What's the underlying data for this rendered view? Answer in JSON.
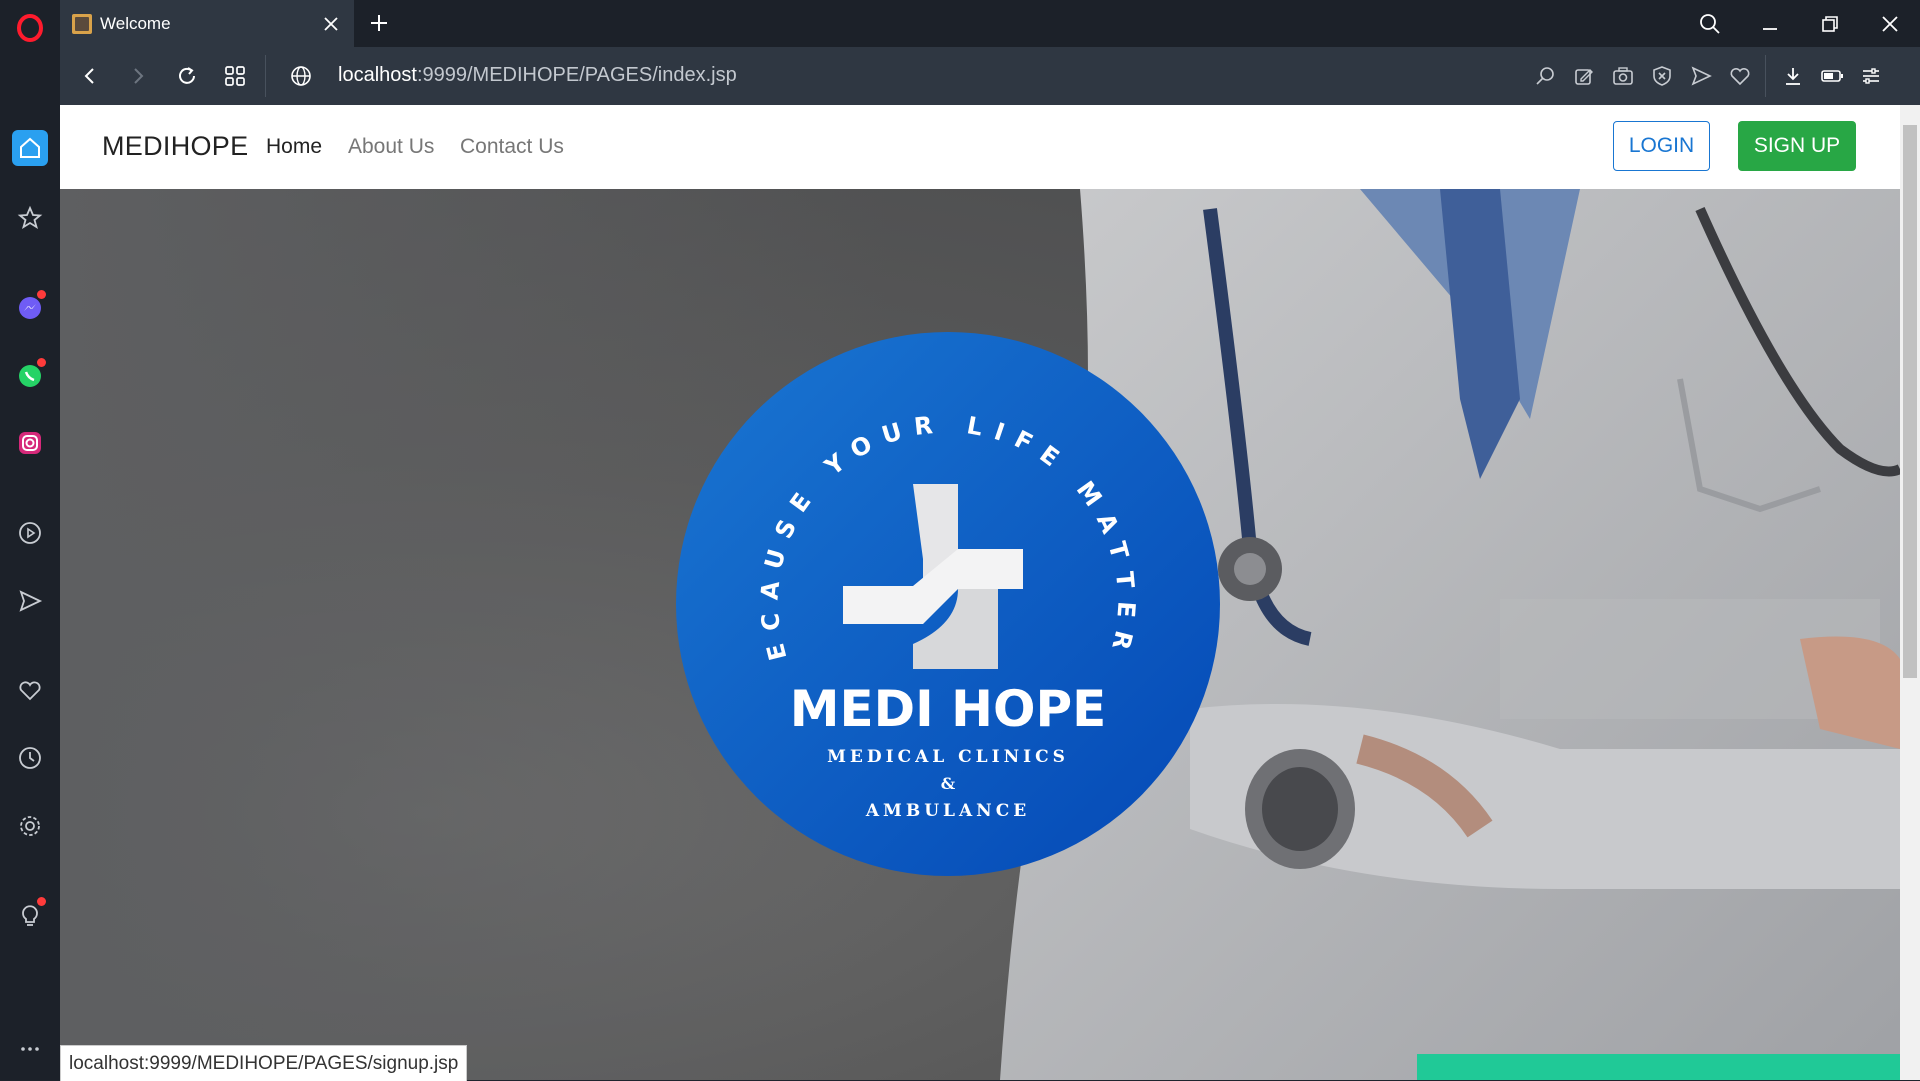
{
  "browser": {
    "tab_title": "Welcome",
    "url_host": "localhost",
    "url_rest": ":9999/MEDIHOPE/PAGES/index.jsp",
    "status_url": "localhost:9999/MEDIHOPE/PAGES/signup.jsp",
    "sidebar_items": [
      "home-icon",
      "star-icon",
      "messenger-icon",
      "whatsapp-icon",
      "instagram-icon",
      "player-icon",
      "flow-icon",
      "heart-icon",
      "history-icon",
      "settings-icon",
      "lightbulb-icon",
      "more-icon"
    ]
  },
  "site": {
    "brand": "MEDIHOPE",
    "nav": [
      "Home",
      "About Us",
      "Contact Us"
    ],
    "login_label": "LOGIN",
    "signup_label": "SIGN UP"
  },
  "logo": {
    "arc_text": "BECAUSE YOUR LIFE MATTERS",
    "name": "MEDI HOPE",
    "line1": "MEDICAL CLINICS",
    "line2": "&",
    "line3": "AMBULANCE"
  },
  "colors": {
    "brand_blue": "#0a5fc4",
    "signup_green": "#28a745",
    "login_blue": "#1976d2",
    "browser_dark": "#1c2129"
  }
}
